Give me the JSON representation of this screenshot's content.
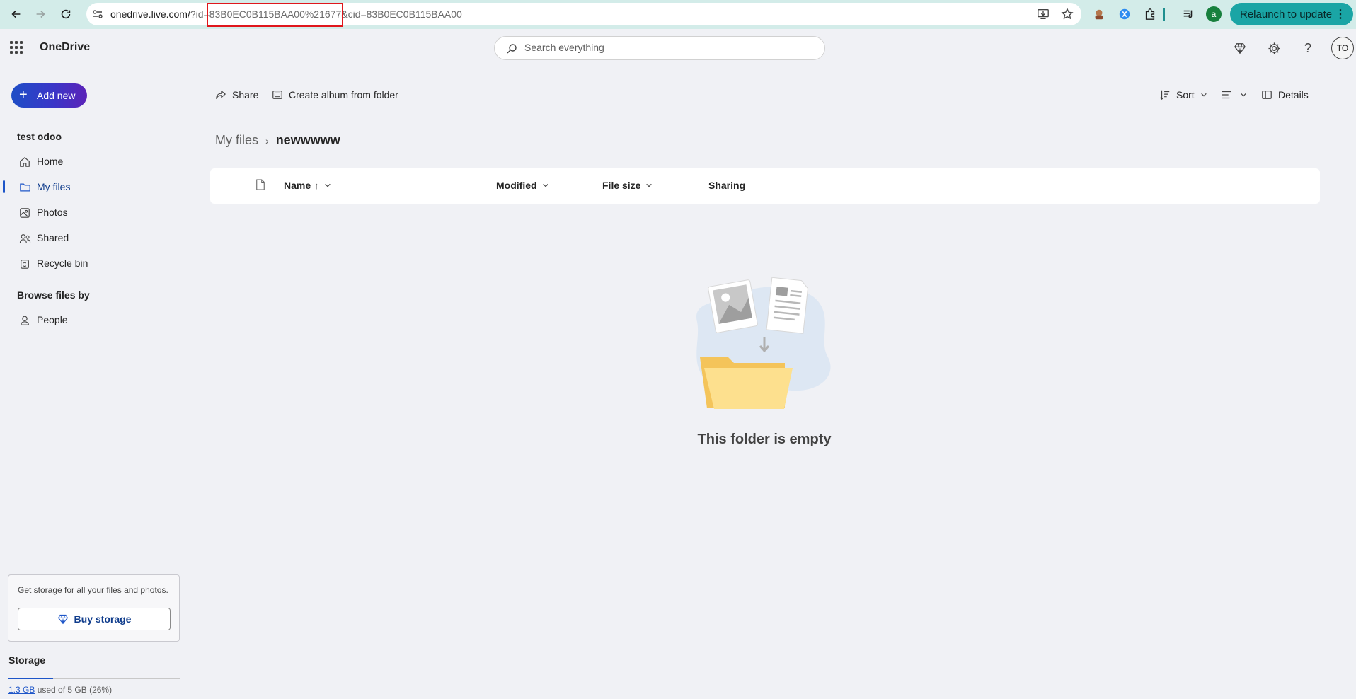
{
  "browser": {
    "url_host": "onedrive.live.com/",
    "url_rest": "?id=83B0EC0B115BAA00%21677&cid=83B0EC0B115BAA00",
    "relaunch_label": "Relaunch to update",
    "profile_initial": "a"
  },
  "header": {
    "brand": "OneDrive",
    "search_placeholder": "Search everything",
    "avatar_initials": "TO"
  },
  "sidebar": {
    "add_new_label": "Add new",
    "account_name": "test odoo",
    "items": [
      {
        "label": "Home",
        "icon": "home-icon"
      },
      {
        "label": "My files",
        "icon": "folder-icon",
        "active": true
      },
      {
        "label": "Photos",
        "icon": "photo-icon"
      },
      {
        "label": "Shared",
        "icon": "people-icon"
      },
      {
        "label": "Recycle bin",
        "icon": "recycle-bin-icon"
      }
    ],
    "browse_label": "Browse files by",
    "browse_items": [
      {
        "label": "People",
        "icon": "person-icon"
      }
    ],
    "storage_promo": "Get storage for all your files and photos.",
    "buy_storage_label": "Buy storage",
    "storage_title": "Storage",
    "storage_used_amount": "1.3 GB",
    "storage_used_suffix": "used of 5 GB (26%)",
    "storage_used_fraction": 0.26
  },
  "commandbar": {
    "share_label": "Share",
    "create_album_label": "Create album from folder",
    "sort_label": "Sort",
    "details_label": "Details"
  },
  "breadcrumb": {
    "root": "My files",
    "current": "newwwww"
  },
  "columns": {
    "name": "Name",
    "name_sort_arrow": "↑",
    "modified": "Modified",
    "file_size": "File size",
    "sharing": "Sharing"
  },
  "empty_state": {
    "message": "This folder is empty"
  },
  "colors": {
    "accent": "#1d55c8",
    "browser_bar": "#d3ece9",
    "relaunch_button": "#1aa5a5",
    "highlight_box": "#e0171c"
  }
}
